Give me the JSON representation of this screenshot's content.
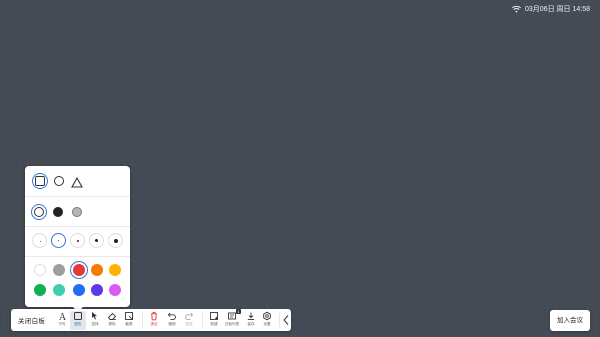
{
  "status": {
    "datetime": "03月06日 周日 14:58",
    "wifi_icon": "wifi-icon"
  },
  "shape_panel": {
    "shapes": [
      {
        "name": "square",
        "selected": true
      },
      {
        "name": "circle",
        "selected": false
      },
      {
        "name": "triangle",
        "selected": false
      }
    ],
    "fill_modes": [
      {
        "name": "outline",
        "selected": true
      },
      {
        "name": "solid-fill",
        "selected": false
      },
      {
        "name": "semi-fill",
        "selected": false
      }
    ],
    "stroke_sizes": [
      {
        "level": 1,
        "selected": false
      },
      {
        "level": 2,
        "selected": true
      },
      {
        "level": 3,
        "selected": false
      },
      {
        "level": 4,
        "selected": false
      },
      {
        "level": 5,
        "selected": false
      }
    ],
    "colors": [
      "#ffffff",
      "#9e9e9e",
      "#e53935",
      "#f57c00",
      "#ffb300",
      "#11b04f",
      "#3ecfb0",
      "#1e6df2",
      "#5b3be8",
      "#d65cf2"
    ],
    "selected_color": "#e53935"
  },
  "toolbar": {
    "close_label": "关闭白板",
    "pen_label": "书写",
    "shape_label": "图形",
    "select_label": "选择",
    "eraser_label": "擦除",
    "snapshot_label": "截屏",
    "clear_label": "清空",
    "undo_label": "撤销",
    "redo_label": "重做",
    "newpage_label": "新建",
    "pages_label": "白板列表",
    "pages_badge": "1",
    "save_label": "保存",
    "settings_label": "设置",
    "collapse_icon": "chevron-left-icon"
  },
  "join_button": "加入会议"
}
